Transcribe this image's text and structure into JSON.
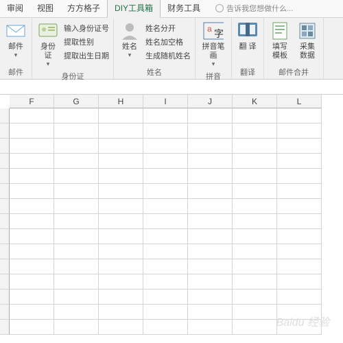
{
  "tabs": {
    "items": [
      "审阅",
      "视图",
      "方方格子",
      "DIY工具箱",
      "财务工具"
    ],
    "active_index": 3,
    "hint": "告诉我您想做什么..."
  },
  "ribbon": {
    "groups": [
      {
        "label": "邮件",
        "big_buttons": [
          {
            "label": "邮件",
            "dropdown": true,
            "icon": "mail-icon"
          }
        ]
      },
      {
        "label": "身份证",
        "big_buttons": [
          {
            "label": "身份\n证",
            "dropdown": true,
            "icon": "idcard-icon"
          }
        ],
        "small_items": [
          "输入身份证号",
          "提取性别",
          "提取出生日期"
        ]
      },
      {
        "label": "姓名",
        "big_buttons": [
          {
            "label": "姓名",
            "dropdown": true,
            "icon": "person-icon"
          }
        ],
        "small_items": [
          "姓名分开",
          "姓名加空格",
          "生成随机姓名"
        ]
      },
      {
        "label": "拼音",
        "big_buttons": [
          {
            "label": "拼音笔\n画",
            "dropdown": true,
            "icon": "pinyin-icon"
          }
        ]
      },
      {
        "label": "翻译",
        "big_buttons": [
          {
            "label": "翻\n译",
            "dropdown": false,
            "icon": "translate-icon"
          }
        ]
      },
      {
        "label": "邮件合并",
        "big_buttons": [
          {
            "label": "填写\n模板",
            "dropdown": false,
            "icon": "template-icon"
          },
          {
            "label": "采集\n数据",
            "dropdown": false,
            "icon": "collect-icon"
          }
        ]
      }
    ]
  },
  "columns": [
    "F",
    "G",
    "H",
    "I",
    "J",
    "K",
    "L"
  ],
  "row_count": 15,
  "watermark": "Baidu 经验"
}
